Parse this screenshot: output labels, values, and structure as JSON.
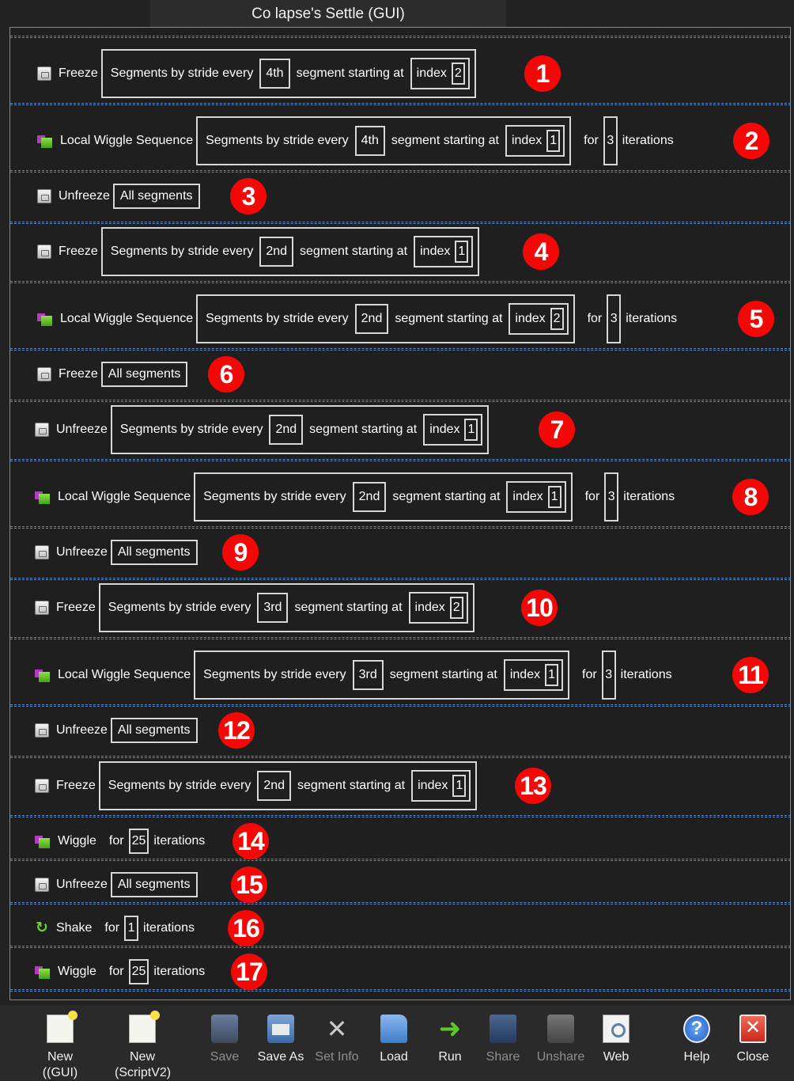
{
  "window": {
    "title": "Co lapse's Settle (GUI)"
  },
  "steps": [
    {
      "action": "Freeze",
      "icon": "lock-icon",
      "target": "Segments by stride every",
      "stride": "4th",
      "mid": "segment starting at",
      "index_label": "index",
      "index": "2",
      "badge": "1"
    },
    {
      "action": "Local Wiggle Sequence",
      "icon": "wiggle-icon",
      "target": "Segments by stride every",
      "stride": "4th",
      "mid": "segment starting at",
      "index_label": "index",
      "index": "1",
      "for": "for",
      "iterations": "3",
      "iter_label": "iterations",
      "badge": "2"
    },
    {
      "action": "Unfreeze",
      "icon": "lock-icon",
      "target": "All segments",
      "badge": "3"
    },
    {
      "action": "Freeze",
      "icon": "lock-icon",
      "target": "Segments by stride every",
      "stride": "2nd",
      "mid": "segment starting at",
      "index_label": "index",
      "index": "1",
      "badge": "4"
    },
    {
      "action": "Local Wiggle Sequence",
      "icon": "wiggle-icon",
      "target": "Segments by stride every",
      "stride": "2nd",
      "mid": "segment starting at",
      "index_label": "index",
      "index": "2",
      "for": "for",
      "iterations": "3",
      "iter_label": "iterations",
      "badge": "5"
    },
    {
      "action": "Freeze",
      "icon": "lock-icon",
      "target": "All segments",
      "badge": "6"
    },
    {
      "action": "Unfreeze",
      "icon": "lock-icon",
      "target": "Segments by stride every",
      "stride": "2nd",
      "mid": "segment starting at",
      "index_label": "index",
      "index": "1",
      "badge": "7"
    },
    {
      "action": "Local Wiggle Sequence",
      "icon": "wiggle-icon",
      "target": "Segments by stride every",
      "stride": "2nd",
      "mid": "segment starting at",
      "index_label": "index",
      "index": "1",
      "for": "for",
      "iterations": "3",
      "iter_label": "iterations",
      "badge": "8"
    },
    {
      "action": "Unfreeze",
      "icon": "lock-icon",
      "target": "All segments",
      "badge": "9"
    },
    {
      "action": "Freeze",
      "icon": "lock-icon",
      "target": "Segments by stride every",
      "stride": "3rd",
      "mid": "segment starting at",
      "index_label": "index",
      "index": "2",
      "badge": "10"
    },
    {
      "action": "Local Wiggle Sequence",
      "icon": "wiggle-icon",
      "target": "Segments by stride every",
      "stride": "3rd",
      "mid": "segment starting at",
      "index_label": "index",
      "index": "1",
      "for": "for",
      "iterations": "3",
      "iter_label": "iterations",
      "badge": "11"
    },
    {
      "action": "Unfreeze",
      "icon": "lock-icon",
      "target": "All segments",
      "badge": "12"
    },
    {
      "action": "Freeze",
      "icon": "lock-icon",
      "target": "Segments by stride every",
      "stride": "2nd",
      "mid": "segment starting at",
      "index_label": "index",
      "index": "1",
      "badge": "13"
    },
    {
      "action": "Wiggle",
      "icon": "wiggle-icon",
      "for": "for",
      "iterations": "25",
      "iter_label": "iterations",
      "badge": "14"
    },
    {
      "action": "Unfreeze",
      "icon": "lock-icon",
      "target": "All segments",
      "badge": "15"
    },
    {
      "action": "Shake",
      "icon": "shake-icon",
      "for": "for",
      "iterations": "1",
      "iter_label": "iterations",
      "badge": "16"
    },
    {
      "action": "Wiggle",
      "icon": "wiggle-icon",
      "for": "for",
      "iterations": "25",
      "iter_label": "iterations",
      "badge": "17"
    }
  ],
  "toolbar": {
    "new_gui": "New\n((GUI)",
    "new_script": "New\n(ScriptV2)",
    "save": "Save",
    "save_as": "Save As",
    "set_info": "Set Info",
    "load": "Load",
    "run": "Run",
    "share": "Share",
    "unshare": "Unshare",
    "web": "Web",
    "help": "Help",
    "close": "Close"
  },
  "colors": {
    "badge": "#f40707",
    "separator": "#5a86c4",
    "background": "#222222"
  }
}
